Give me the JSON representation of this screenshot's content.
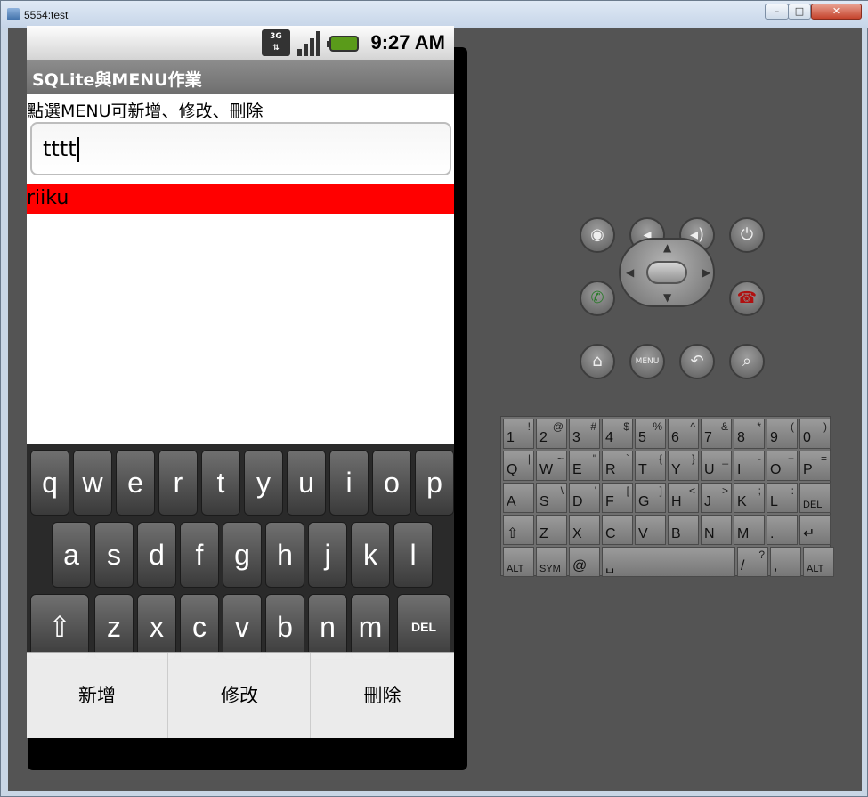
{
  "window": {
    "title": "5554:test"
  },
  "status": {
    "time": "9:27 AM",
    "network": "3G"
  },
  "app": {
    "title": "SQLite與MENU作業",
    "hint": "點選MENU可新增、修改、刪除",
    "input_value": "tttt",
    "list_items": [
      "riiku"
    ]
  },
  "keyboard": {
    "row1": [
      "q",
      "w",
      "e",
      "r",
      "t",
      "y",
      "u",
      "i",
      "o",
      "p"
    ],
    "row2": [
      "a",
      "s",
      "d",
      "f",
      "g",
      "h",
      "j",
      "k",
      "l"
    ],
    "row3": [
      "z",
      "x",
      "c",
      "v",
      "b",
      "n",
      "m"
    ],
    "shift": "⇧",
    "del": "DEL"
  },
  "menu": {
    "add": "新增",
    "edit": "修改",
    "delete": "刪除"
  },
  "hw_keys": {
    "row1": [
      [
        "1",
        "!"
      ],
      [
        "2",
        "@"
      ],
      [
        "3",
        "#"
      ],
      [
        "4",
        "$"
      ],
      [
        "5",
        "%"
      ],
      [
        "6",
        "^"
      ],
      [
        "7",
        "&"
      ],
      [
        "8",
        "*"
      ],
      [
        "9",
        "("
      ],
      [
        "0",
        ")"
      ]
    ],
    "row2": [
      [
        "Q",
        "|"
      ],
      [
        "W",
        "~"
      ],
      [
        "E",
        "\""
      ],
      [
        "R",
        "`"
      ],
      [
        "T",
        "{"
      ],
      [
        "Y",
        "}"
      ],
      [
        "U",
        "_"
      ],
      [
        "I",
        "-"
      ],
      [
        "O",
        "+"
      ],
      [
        "P",
        "="
      ]
    ],
    "row3": [
      [
        "A",
        ""
      ],
      [
        "S",
        "\\"
      ],
      [
        "D",
        "'"
      ],
      [
        "F",
        "["
      ],
      [
        "G",
        "]"
      ],
      [
        "H",
        "<"
      ],
      [
        "J",
        ">"
      ],
      [
        "K",
        ";"
      ],
      [
        "L",
        ":"
      ],
      [
        "DEL",
        ""
      ]
    ],
    "row4": [
      [
        "⇧",
        ""
      ],
      [
        "Z",
        ""
      ],
      [
        "X",
        ""
      ],
      [
        "C",
        ""
      ],
      [
        "V",
        ""
      ],
      [
        "B",
        ""
      ],
      [
        "N",
        ""
      ],
      [
        "M",
        ""
      ],
      [
        ".",
        ""
      ],
      [
        "↵",
        ""
      ]
    ],
    "row5": [
      [
        "ALT",
        ""
      ],
      [
        "SYM",
        ""
      ],
      [
        "@",
        ""
      ],
      [
        "␣",
        ""
      ],
      [
        "/",
        "?"
      ],
      [
        ",",
        ""
      ],
      [
        "ALT",
        ""
      ]
    ]
  }
}
